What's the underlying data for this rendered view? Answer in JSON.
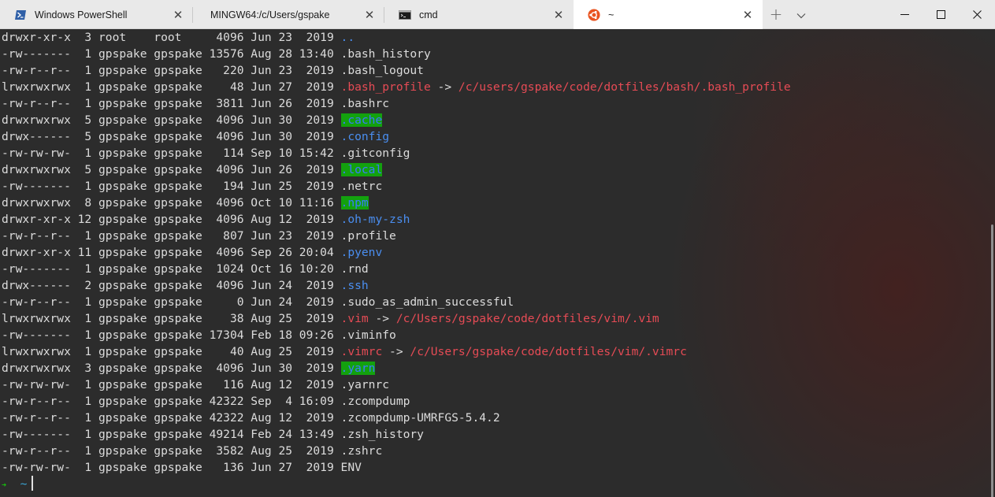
{
  "tabs": [
    {
      "label": "Windows PowerShell",
      "icon": "powershell-icon",
      "close": "✕"
    },
    {
      "label": "MINGW64:/c/Users/gspake",
      "icon": "",
      "close": "✕"
    },
    {
      "label": "cmd",
      "icon": "cmd-icon",
      "close": "✕"
    },
    {
      "label": "~",
      "icon": "ubuntu-icon",
      "close": "✕"
    }
  ],
  "tabbar": {
    "new_tab": "+",
    "minimize": "—",
    "maximize": "☐",
    "close": "✕"
  },
  "colors": {
    "accent_blue": "#4a8ef0",
    "link_red": "#e64b55",
    "dir_highlight": "#13a10e",
    "prompt_green": "#16c60c"
  },
  "listing": [
    {
      "meta": "drwxr-xr-x  3 root    root     4096 Jun 23  2019 ",
      "name": "..",
      "style": "blue"
    },
    {
      "meta": "-rw-------  1 gpspake gpspake 13576 Aug 28 13:40 ",
      "name": ".bash_history",
      "style": "plain"
    },
    {
      "meta": "-rw-r--r--  1 gpspake gpspake   220 Jun 23  2019 ",
      "name": ".bash_logout",
      "style": "plain"
    },
    {
      "meta": "lrwxrwxrwx  1 gpspake gpspake    48 Jun 27  2019 ",
      "name": ".bash_profile",
      "style": "red",
      "arrow": " -> ",
      "target": "/c/users/gspake/code/dotfiles/bash/.bash_profile"
    },
    {
      "meta": "-rw-r--r--  1 gpspake gpspake  3811 Jun 26  2019 ",
      "name": ".bashrc",
      "style": "plain"
    },
    {
      "meta": "drwxrwxrwx  5 gpspake gpspake  4096 Jun 30  2019 ",
      "name": ".cache",
      "style": "hl"
    },
    {
      "meta": "drwx------  5 gpspake gpspake  4096 Jun 30  2019 ",
      "name": ".config",
      "style": "blue"
    },
    {
      "meta": "-rw-rw-rw-  1 gpspake gpspake   114 Sep 10 15:42 ",
      "name": ".gitconfig",
      "style": "plain"
    },
    {
      "meta": "drwxrwxrwx  5 gpspake gpspake  4096 Jun 26  2019 ",
      "name": ".local",
      "style": "hl"
    },
    {
      "meta": "-rw-------  1 gpspake gpspake   194 Jun 25  2019 ",
      "name": ".netrc",
      "style": "plain"
    },
    {
      "meta": "drwxrwxrwx  8 gpspake gpspake  4096 Oct 10 11:16 ",
      "name": ".npm",
      "style": "hl"
    },
    {
      "meta": "drwxr-xr-x 12 gpspake gpspake  4096 Aug 12  2019 ",
      "name": ".oh-my-zsh",
      "style": "blue"
    },
    {
      "meta": "-rw-r--r--  1 gpspake gpspake   807 Jun 23  2019 ",
      "name": ".profile",
      "style": "plain"
    },
    {
      "meta": "drwxr-xr-x 11 gpspake gpspake  4096 Sep 26 20:04 ",
      "name": ".pyenv",
      "style": "blue"
    },
    {
      "meta": "-rw-------  1 gpspake gpspake  1024 Oct 16 10:20 ",
      "name": ".rnd",
      "style": "plain"
    },
    {
      "meta": "drwx------  2 gpspake gpspake  4096 Jun 24  2019 ",
      "name": ".ssh",
      "style": "blue"
    },
    {
      "meta": "-rw-r--r--  1 gpspake gpspake     0 Jun 24  2019 ",
      "name": ".sudo_as_admin_successful",
      "style": "plain"
    },
    {
      "meta": "lrwxrwxrwx  1 gpspake gpspake    38 Aug 25  2019 ",
      "name": ".vim",
      "style": "red",
      "arrow": " -> ",
      "target": "/c/Users/gspake/code/dotfiles/vim/.vim"
    },
    {
      "meta": "-rw-------  1 gpspake gpspake 17304 Feb 18 09:26 ",
      "name": ".viminfo",
      "style": "plain"
    },
    {
      "meta": "lrwxrwxrwx  1 gpspake gpspake    40 Aug 25  2019 ",
      "name": ".vimrc",
      "style": "red",
      "arrow": " -> ",
      "target": "/c/Users/gspake/code/dotfiles/vim/.vimrc"
    },
    {
      "meta": "drwxrwxrwx  3 gpspake gpspake  4096 Jun 30  2019 ",
      "name": ".yarn",
      "style": "hl"
    },
    {
      "meta": "-rw-rw-rw-  1 gpspake gpspake   116 Aug 12  2019 ",
      "name": ".yarnrc",
      "style": "plain"
    },
    {
      "meta": "-rw-r--r--  1 gpspake gpspake 42322 Sep  4 16:09 ",
      "name": ".zcompdump",
      "style": "plain"
    },
    {
      "meta": "-rw-r--r--  1 gpspake gpspake 42322 Aug 12  2019 ",
      "name": ".zcompdump-UMRFGS-5.4.2",
      "style": "plain"
    },
    {
      "meta": "-rw-------  1 gpspake gpspake 49214 Feb 24 13:49 ",
      "name": ".zsh_history",
      "style": "plain"
    },
    {
      "meta": "-rw-r--r--  1 gpspake gpspake  3582 Aug 25  2019 ",
      "name": ".zshrc",
      "style": "plain"
    },
    {
      "meta": "-rw-rw-rw-  1 gpspake gpspake   136 Jun 27  2019 ",
      "name": "ENV",
      "style": "plain"
    }
  ],
  "prompt": {
    "arrow": "➜",
    "dir": "~"
  }
}
